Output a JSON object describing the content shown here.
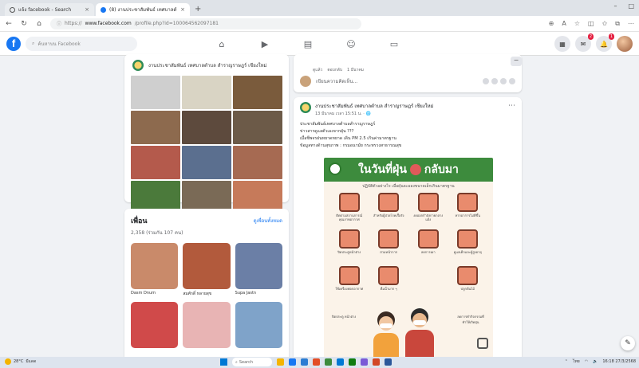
{
  "browser": {
    "tabs": [
      {
        "title": "แจ้ง facebook - Search",
        "close": "×"
      },
      {
        "title": "(8) งานประชาสัมพันธ์ เทศบาลตำบล",
        "close": "×"
      }
    ],
    "new_tab": "+",
    "window_controls": [
      "–",
      "□"
    ],
    "url_prefix": "https://",
    "url_domain": "www.facebook.com",
    "url_path": "/profile.php?id=100064562097181"
  },
  "facebook": {
    "logo": "f",
    "search_placeholder": "ค้นหาบน Facebook",
    "nav_icons": [
      "home-icon",
      "video-icon",
      "marketplace-icon",
      "groups-icon",
      "gaming-icon"
    ],
    "notification_badge": "1",
    "message_badge": "2"
  },
  "left": {
    "page_name": "งานประชาสัมพันธ์ เทศบาลตำบล สำราญราษฎร์ เชียงใหม่",
    "photo_colors": [
      "#cfcfcf",
      "#d9d4c4",
      "#7a5b3c",
      "#8d6a4e",
      "#5d4a3d",
      "#6c5a48",
      "#b45a4c",
      "#5b6f8f",
      "#a66a52",
      "#4b7a3b",
      "#7a6a56",
      "#c67a5a"
    ],
    "friends": {
      "title": "เพื่อน",
      "link": "ดูเพื่อนทั้งหมด",
      "count": "2,358 (ร่วมกัน 107 คน)",
      "items": [
        {
          "name": "Dasm Dnum",
          "color": "#c98a6a"
        },
        {
          "name": "สมศักดิ์ หลายสุข",
          "color": "#b25a3c"
        },
        {
          "name": "Supa Jastn",
          "color": "#6b7fa6"
        },
        {
          "name": "",
          "color": "#d04a4a"
        },
        {
          "name": "",
          "color": "#e8b4b4"
        },
        {
          "name": "",
          "color": "#7fa3c9"
        }
      ]
    }
  },
  "feed": {
    "composer": {
      "meta": [
        "ดูแล้ว",
        "ตอบกลับ",
        "1 มีนาคม"
      ],
      "placeholder": "เขียนความคิดเห็น..."
    },
    "post": {
      "author": "งานประชาสัมพันธ์ เทศบาลตำบล สำราญราษฎร์ เชียงใหม่",
      "time": "13 มีนาคม เวลา 15:51 น. · 🌐",
      "lines": [
        "ประชาสัมพันธ์เทศบาลตำบลสำราญราษฎร์",
        "ข่าวสารดูแลตัวเองจากฝุ่น ???",
        "เมื่อชีพจรฝนหยาดหยาด เดิน PM 2.5 เกินค่ามาตรฐาน",
        "ข้อมูลทางด้านสุขภาพ : กรมอนามัย กระทรวงสาธารณสุข"
      ],
      "infographic": {
        "title_left": "ในวันที่ฝุ่น",
        "title_right": "กลับมา",
        "subtitle": "ปฏิบัติตัวอย่างไร เมื่อฝุ่นละอองขนาดเล็กเกินมาตรฐาน",
        "tips": [
          "ติดตามสถานการณ์คุณภาพอากาศ",
          "สำหรับผู้ป่วยโรคเรื้อรัง",
          "งดออกกำลังกายกลางแจ้ง",
          "หากอาการไม่ดีขึ้น",
          "ปิดประตูหน้าต่าง",
          "สวมหน้ากาก",
          "ลดการเผา",
          "ดูแลเด็กและผู้สูงอายุ",
          "ใช้เครื่องฟอกอากาศ",
          "ดื่มน้ำมาก ๆ",
          "",
          "ปลูกต้นไม้"
        ],
        "bottom_left": "ปิดประตู หน้าต่าง",
        "bottom_right": "ลดการทำกิจกรรมที่ทำให้เกิดฝุ่น"
      }
    }
  },
  "taskbar": {
    "temp": "28°C",
    "condition": "มีแดด",
    "search": "Search",
    "time": "16:18",
    "date": "27/3/2568",
    "lang": "ไทย",
    "app_colors": [
      "#f4b400",
      "#1877f2",
      "#2b7cd3",
      "#e34d26",
      "#3d8b3d",
      "#0078d4",
      "#107c10",
      "#7a5bd6",
      "#d24726",
      "#2b579a"
    ]
  }
}
